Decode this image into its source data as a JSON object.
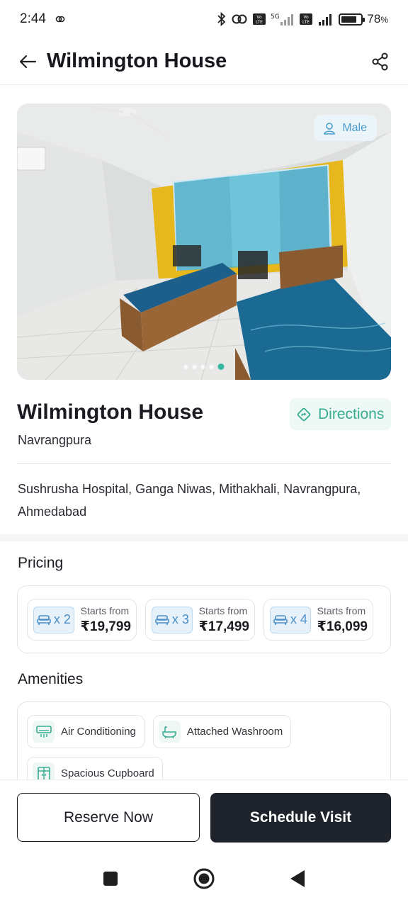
{
  "status_bar": {
    "time": "2:44",
    "battery_percent": "78",
    "battery_unit": "%",
    "battery_level": 0.78,
    "network": "5G",
    "icons": [
      "link-icon",
      "bluetooth-icon",
      "hotspot-icon",
      "volte-icon",
      "signal-icon",
      "battery-icon"
    ]
  },
  "app_bar": {
    "title": "Wilmington House",
    "back_icon": "arrow-left-icon",
    "share_icon": "share-icon"
  },
  "hero": {
    "gender_label": "Male",
    "image_count": 5,
    "active_image_index": 4
  },
  "property": {
    "name": "Wilmington House",
    "locality": "Navrangpura",
    "directions_label": "Directions",
    "address": "Sushrusha Hospital, Ganga Niwas, Mithakhali, Navrangpura, Ahmedabad"
  },
  "pricing": {
    "title": "Pricing",
    "items": [
      {
        "occupancy": "x 2",
        "starts_from": "Starts from",
        "price": "₹19,799"
      },
      {
        "occupancy": "x 3",
        "starts_from": "Starts from",
        "price": "₹17,499"
      },
      {
        "occupancy": "x 4",
        "starts_from": "Starts from",
        "price": "₹16,099"
      }
    ]
  },
  "amenities": {
    "title": "Amenities",
    "items": [
      {
        "label": "Air Conditioning",
        "icon": "air-conditioner-icon"
      },
      {
        "label": "Attached Washroom",
        "icon": "bathtub-icon"
      },
      {
        "label": "Spacious Cupboard",
        "icon": "cupboard-icon"
      }
    ]
  },
  "actions": {
    "reserve_label": "Reserve Now",
    "visit_label": "Schedule Visit"
  },
  "colors": {
    "accent_teal": "#36ad90",
    "primary_dark": "#1f232b",
    "badge_blue": "#4c8ec8"
  }
}
